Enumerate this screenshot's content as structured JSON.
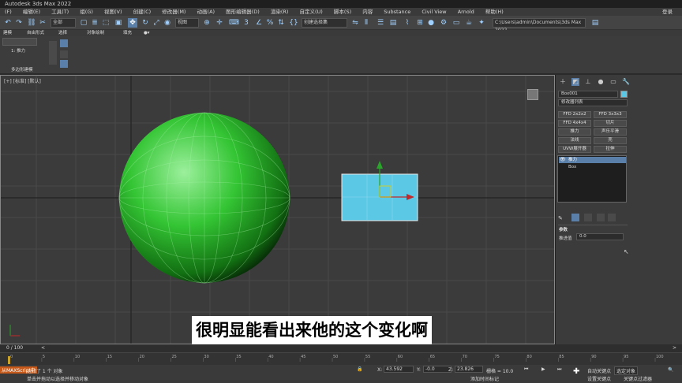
{
  "app": {
    "title": "Autodesk 3ds Max 2022"
  },
  "menu": {
    "items": [
      "(F)",
      "编辑(E)",
      "工具(T)",
      "组(G)",
      "视图(V)",
      "创建(C)",
      "修改器(M)",
      "动画(A)",
      "图形编辑器(D)",
      "渲染(R)",
      "自定义(U)",
      "脚本(S)",
      "内容",
      "Substance",
      "Civil View",
      "Arnold",
      "帮助(H)"
    ],
    "user": "登录"
  },
  "toolbar": {
    "selection_filter": "全部",
    "view_dropdown": "视图",
    "selection_set": "创建选择集",
    "path": "C:\\Users\\admin\\Documents\\3ds Max 2022"
  },
  "ribbon": {
    "tabs": [
      "建模",
      "自由形式",
      "选择",
      "对象绘制",
      "填充"
    ],
    "sub_label": "多边形建模",
    "level": "1: 推力"
  },
  "viewport": {
    "label": "[+] [标准] [默认]",
    "min_frame": "0 / 100"
  },
  "command_panel": {
    "object_name": "Box001",
    "object_color": "#5bc8e6",
    "modifier_list": "修改器列表",
    "buttons": [
      "FFD 2x2x2",
      "FFD 3x3x3",
      "FFD 4x4x4",
      "切片",
      "推力",
      "声乐平滑",
      "法线",
      "壳",
      "UVW展开器",
      "拉伸"
    ],
    "stack_items": [
      "推力",
      "Box"
    ],
    "params_title": "参数",
    "push_label": "推进值",
    "push_value": "0.0"
  },
  "subtitle": "很明显能看出来他的这个变化啊",
  "timeline": {
    "frame": "0 / 100",
    "ticks": [
      "0",
      "5",
      "10",
      "15",
      "20",
      "25",
      "30",
      "35",
      "40",
      "45",
      "50",
      "55",
      "60",
      "65",
      "70",
      "75",
      "80",
      "85",
      "90",
      "95",
      "100"
    ]
  },
  "status": {
    "selected": "选择了 1 个 对象",
    "hint": "单击并拖动以选择并移动对象",
    "left_tag": "从MAXScript中",
    "x_label": "X:",
    "x_value": "43.592",
    "y_label": "Y:",
    "y_value": "-0.0",
    "z_label": "Z:",
    "z_value": "23.826",
    "grid": "栅格 = 10.0",
    "time_tag": "添加时间标记",
    "auto_key": "自动关键点",
    "set_key": "设置关键点",
    "selected_obj": "选定对象",
    "key_filter": "关键点过滤器"
  }
}
